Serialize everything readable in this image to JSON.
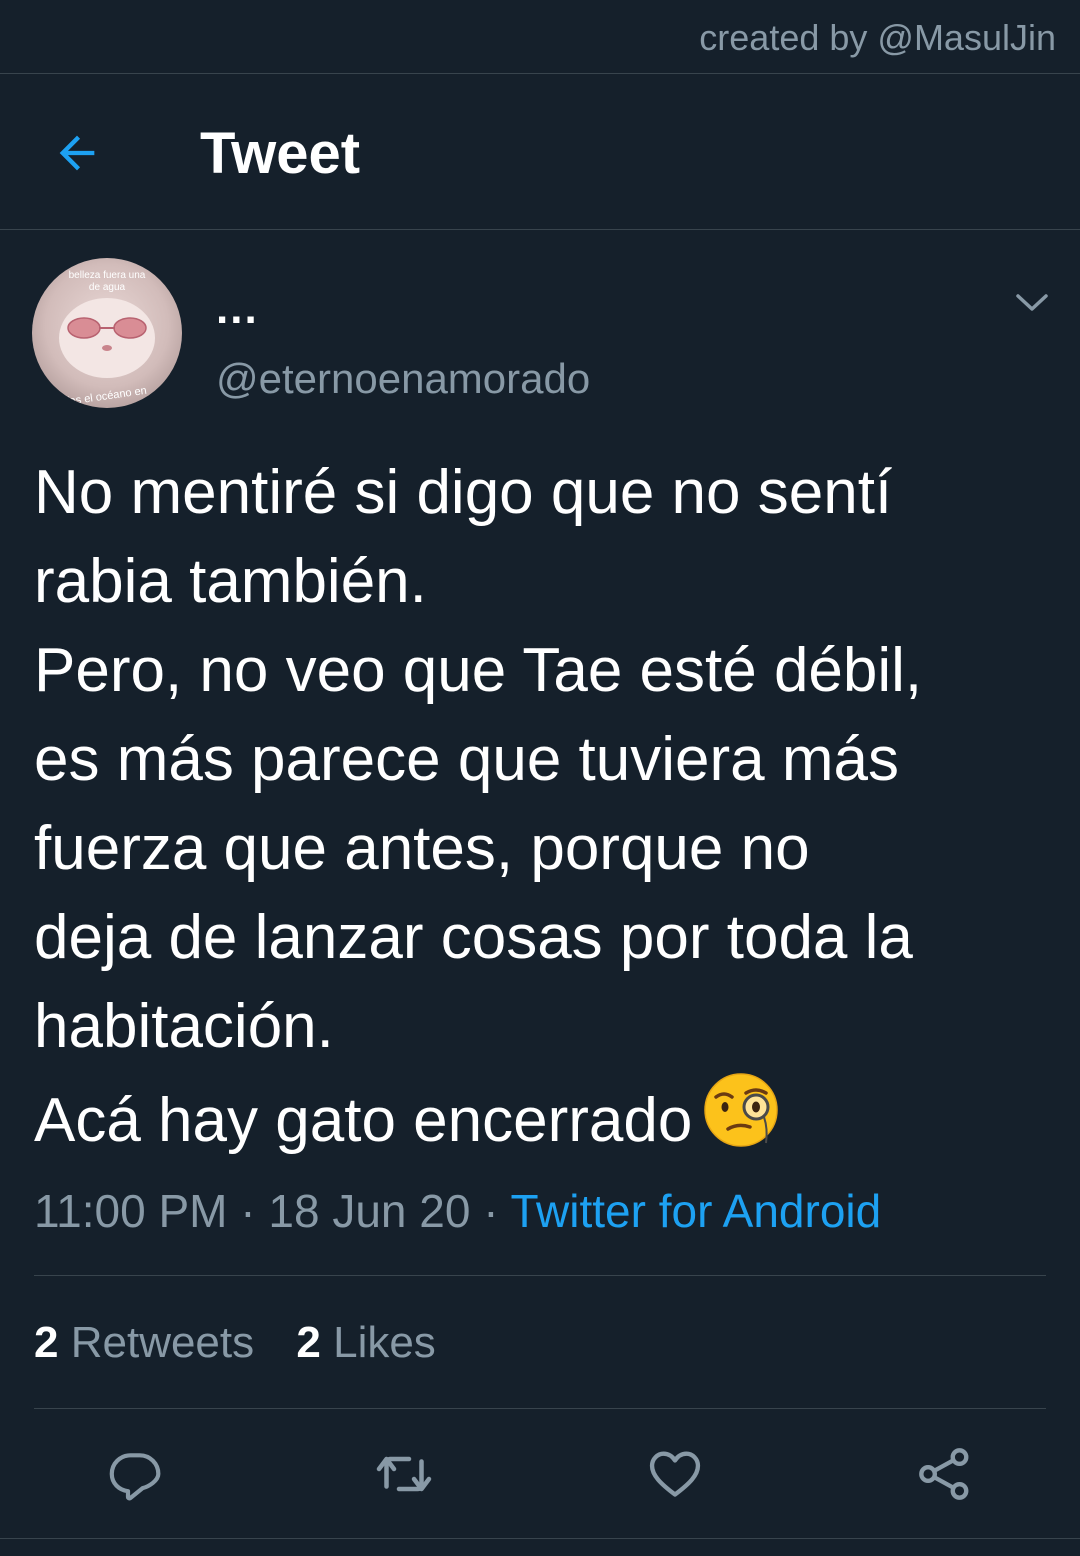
{
  "watermark": "created by @MasulJin",
  "header": {
    "title": "Tweet",
    "back_icon": "arrow-left-icon"
  },
  "colors": {
    "background": "#15202b",
    "accent": "#1da1f2",
    "secondary_text": "#8899a6",
    "divider": "#38444d"
  },
  "tweet": {
    "avatar_text_top": "belleza fuera una de agua",
    "avatar_text_bottom": "erías el océano en",
    "display_name": "...",
    "handle": "@eternoenamorado",
    "text_lines": [
      "No mentiré si digo que no sentí",
      "rabia también.",
      "Pero, no veo que Tae esté débil,",
      "es más parece que tuviera más",
      "fuerza que antes, porque no",
      "deja de lanzar cosas por toda la",
      "habitación.",
      "Acá hay gato encerrado"
    ],
    "emoji": "face-with-monocle",
    "time": "11:00 PM",
    "separator": "·",
    "date": "18 Jun 20",
    "source": "Twitter for Android",
    "retweet_count": "2",
    "retweet_label": "Retweets",
    "like_count": "2",
    "like_label": "Likes"
  },
  "actions": [
    "reply-icon",
    "retweet-icon",
    "like-icon",
    "share-icon"
  ]
}
